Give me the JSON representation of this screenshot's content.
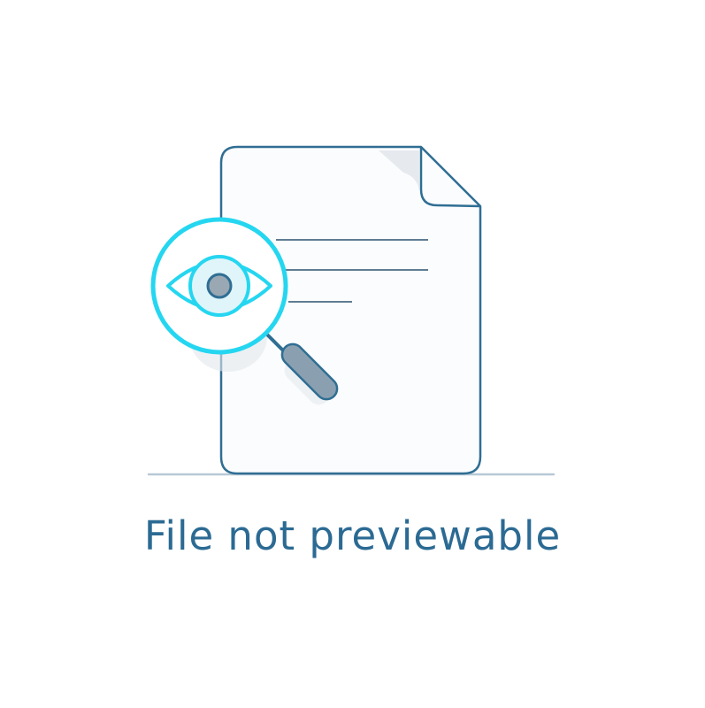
{
  "empty_state": {
    "message": "File not previewable",
    "icons": {
      "document": "document-icon",
      "magnifier": "magnifier-icon",
      "eye": "eye-icon"
    }
  },
  "colors": {
    "document_outline": "#2f6e93",
    "page_fill": "#fbfcfd",
    "fold_fill": "#e6eaee",
    "text_line": "#5f7c92",
    "lens_ring": "#25d6f0",
    "lens_fill": "#ffffff",
    "iris_fill": "#dff5fa",
    "pupil_fill": "#9aa8b4",
    "handle_fill": "#8aa0b0",
    "shadow": "#e3e8ec",
    "baseline": "#b8c9d6",
    "message_text": "#2b6a93"
  }
}
